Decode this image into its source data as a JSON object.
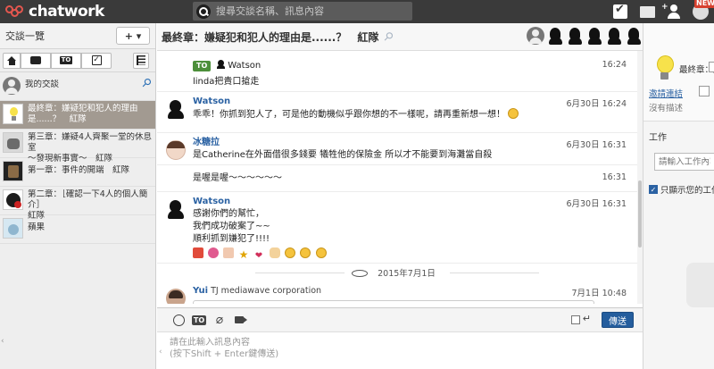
{
  "app": {
    "logo_text": "chatwork",
    "search_placeholder": "搜尋交談名稱、訊息內容",
    "new_badge": "NEW",
    "add_contact_plus": "+"
  },
  "sidebar": {
    "title": "交談一覽",
    "add_label": "+ ▾",
    "filter_to_label": "TO",
    "filter_task_label": "✓",
    "rooms": [
      {
        "name": "我的交談",
        "line2": "",
        "avatar": "mine-icon",
        "pinned": true
      },
      {
        "name": "最終章：嫌疑犯和犯人的理由",
        "line2": "是......？　紅隊",
        "avatar": "bulb-icon",
        "selected": true
      },
      {
        "name": "第三章：嫌疑4人齊聚一堂的休息室",
        "line2": "～發現新事實～　紅隊",
        "avatar": "people-icon"
      },
      {
        "name": "第一章：事件的開端　紅隊",
        "line2": "",
        "avatar": "dark-room-icon"
      },
      {
        "name": "第二章：［確認一下4人的個人簡介］",
        "line2": "紅隊",
        "avatar": "red-team-icon"
      },
      {
        "name": "蘋果",
        "line2": "",
        "avatar": "apple-icon"
      }
    ]
  },
  "room": {
    "title": "最終章：嫌疑犯和犯人的理由是......？　紅隊"
  },
  "messages": [
    {
      "name": "",
      "to_tag": "TO",
      "to_name": "Watson",
      "body": [
        "linda把貴口搶走"
      ],
      "time": "16:24",
      "avatar": ""
    },
    {
      "name": "Watson",
      "body": [
        "乖乖！你抓到犯人了，可是他的動機似乎跟你想的不一樣呢，請再重新想一想！"
      ],
      "time": "6月30日 16:24",
      "avatar": "watson-icon"
    },
    {
      "name": "冰糖拉",
      "body": [
        "是Catherine在外面借很多錢要 犧牲他的保險金 所以才不能要到海灘當自殺"
      ],
      "time": "6月30日 16:31",
      "avatar": "girl-icon"
    },
    {
      "name": "",
      "body": [
        "是喔是喔～～～～～～"
      ],
      "time": "16:31",
      "avatar": ""
    },
    {
      "name": "Watson",
      "body": [
        "感謝你們的幫忙，",
        "我們成功破案了~~",
        "順利抓到嫌犯了!!!!"
      ],
      "time": "6月30日 16:31",
      "avatar": "watson-icon"
    }
  ],
  "date_separator": "2015年7月1日",
  "last_message": {
    "name": "Yui",
    "org": "TJ mediawave corporation",
    "time": "7月1日 10:48"
  },
  "compose": {
    "placeholder_line1": "請在此輸入訊息內容",
    "placeholder_line2": "(按下Shift + Enter鍵傳送)",
    "to_label": "TO",
    "enter_symbol": "↵",
    "send_label": "傳送"
  },
  "right_panel": {
    "room_title": "最終章：嫌",
    "invite_label": "邀請連結",
    "description": "沒有描述",
    "tasks_title": "工作",
    "task_input_placeholder": "請輸入工作內容",
    "show_mine_label": "只顯示您的工作"
  },
  "colors": {
    "topbar": "#3a3a3a",
    "accent_blue": "#245d9d",
    "selected_room": "#a29a91",
    "to_green": "#4c8f3a"
  }
}
